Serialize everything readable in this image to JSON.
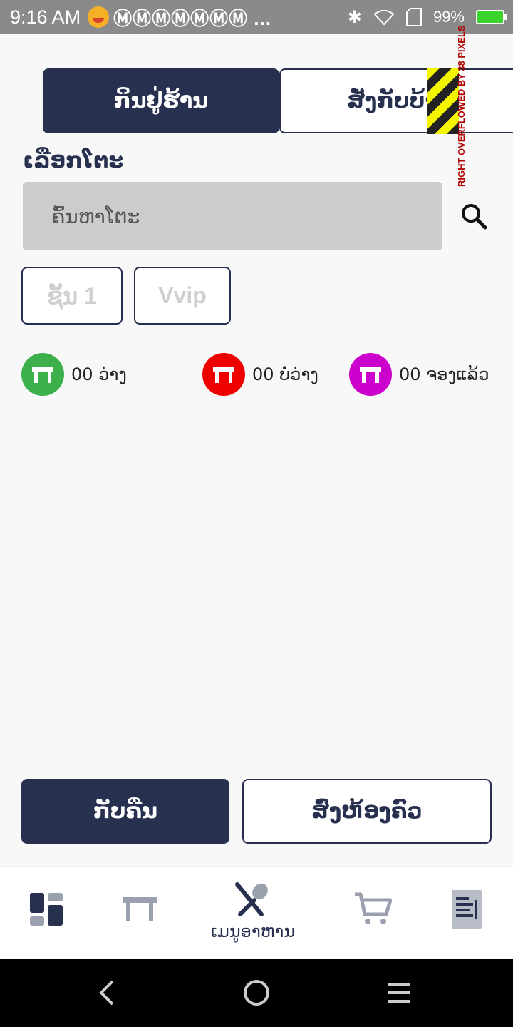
{
  "status_bar": {
    "time": "9:16 AM",
    "notifications": "ⓂⓂⓂⓂⓂⓂⓂ ...",
    "battery": "99%"
  },
  "tabs": {
    "dine_in": "ກິນຢູ່ຮ້ານ",
    "take_home": "ສັ່ງກັບບ້ານ"
  },
  "debug_overflow": "RIGHT OVERFLOWED BY 38 PIXELS",
  "table_select": {
    "label": "ເລືອກໂຕະ",
    "search_placeholder": "ຄົ້ນຫາໂຕະ"
  },
  "zones": [
    "ຊັ້ນ 1",
    "Vvip"
  ],
  "legend": [
    {
      "count": "00",
      "label": "ວ່າງ",
      "color": "#3cb04a"
    },
    {
      "count": "00",
      "label": "ບໍ່ວ່າງ",
      "color": "#ee0000"
    },
    {
      "count": "00",
      "label": "ຈອງແລ້ວ",
      "color": "#cc00cc"
    }
  ],
  "actions": {
    "home": "ກັບຄືນ",
    "send_kitchen": "ສົ່ງຫ້ອງຄົວ"
  },
  "bottom_nav": {
    "active_label": "ເມນູອາຫານ",
    "items": [
      "dashboard-icon",
      "table-icon",
      "food-menu-icon",
      "cart-icon",
      "receipt-icon"
    ]
  },
  "colors": {
    "primary": "#283050",
    "search_bg": "#cccccc"
  }
}
